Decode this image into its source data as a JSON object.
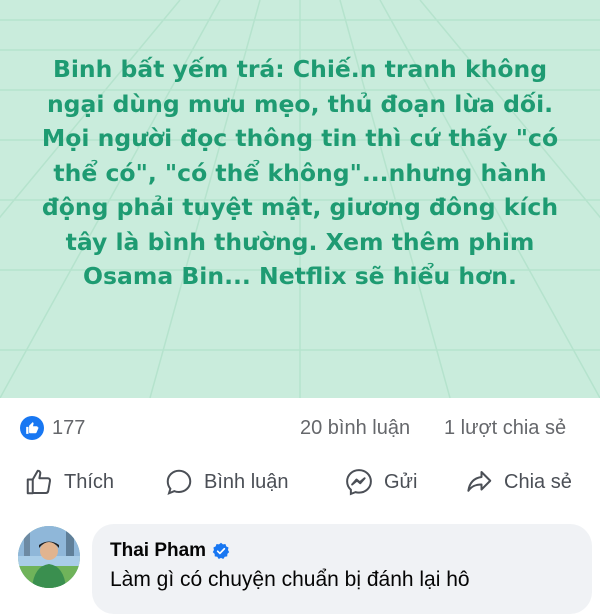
{
  "post": {
    "text": "Binh bất yếm trá: Chiế.n tranh không ngại dùng mưu mẹo, thủ đoạn lừa dối. Mọi người đọc thông tin thì cứ thấy \"có thể có\", \"có thể không\"...nhưng hành động phải tuyệt mật, giương đông kích tây là bình thường. Xem thêm phim Osama Bin... Netflix sẽ hiểu hơn.",
    "background_color": "#c9ecdc",
    "text_color": "#1e9b72"
  },
  "stats": {
    "reactions_icon": "like-icon",
    "reactions_count": "177",
    "comments": "20 bình luận",
    "shares": "1 lượt chia sẻ"
  },
  "actions": {
    "like": "Thích",
    "comment": "Bình luận",
    "send": "Gửi",
    "share": "Chia sẻ"
  },
  "comment": {
    "author": "Thai Pham",
    "verified": true,
    "text": "Làm gì có chuyện chuẩn bị đánh lại hô"
  },
  "colors": {
    "accent": "#1877f2",
    "muted_text": "#65676b"
  }
}
